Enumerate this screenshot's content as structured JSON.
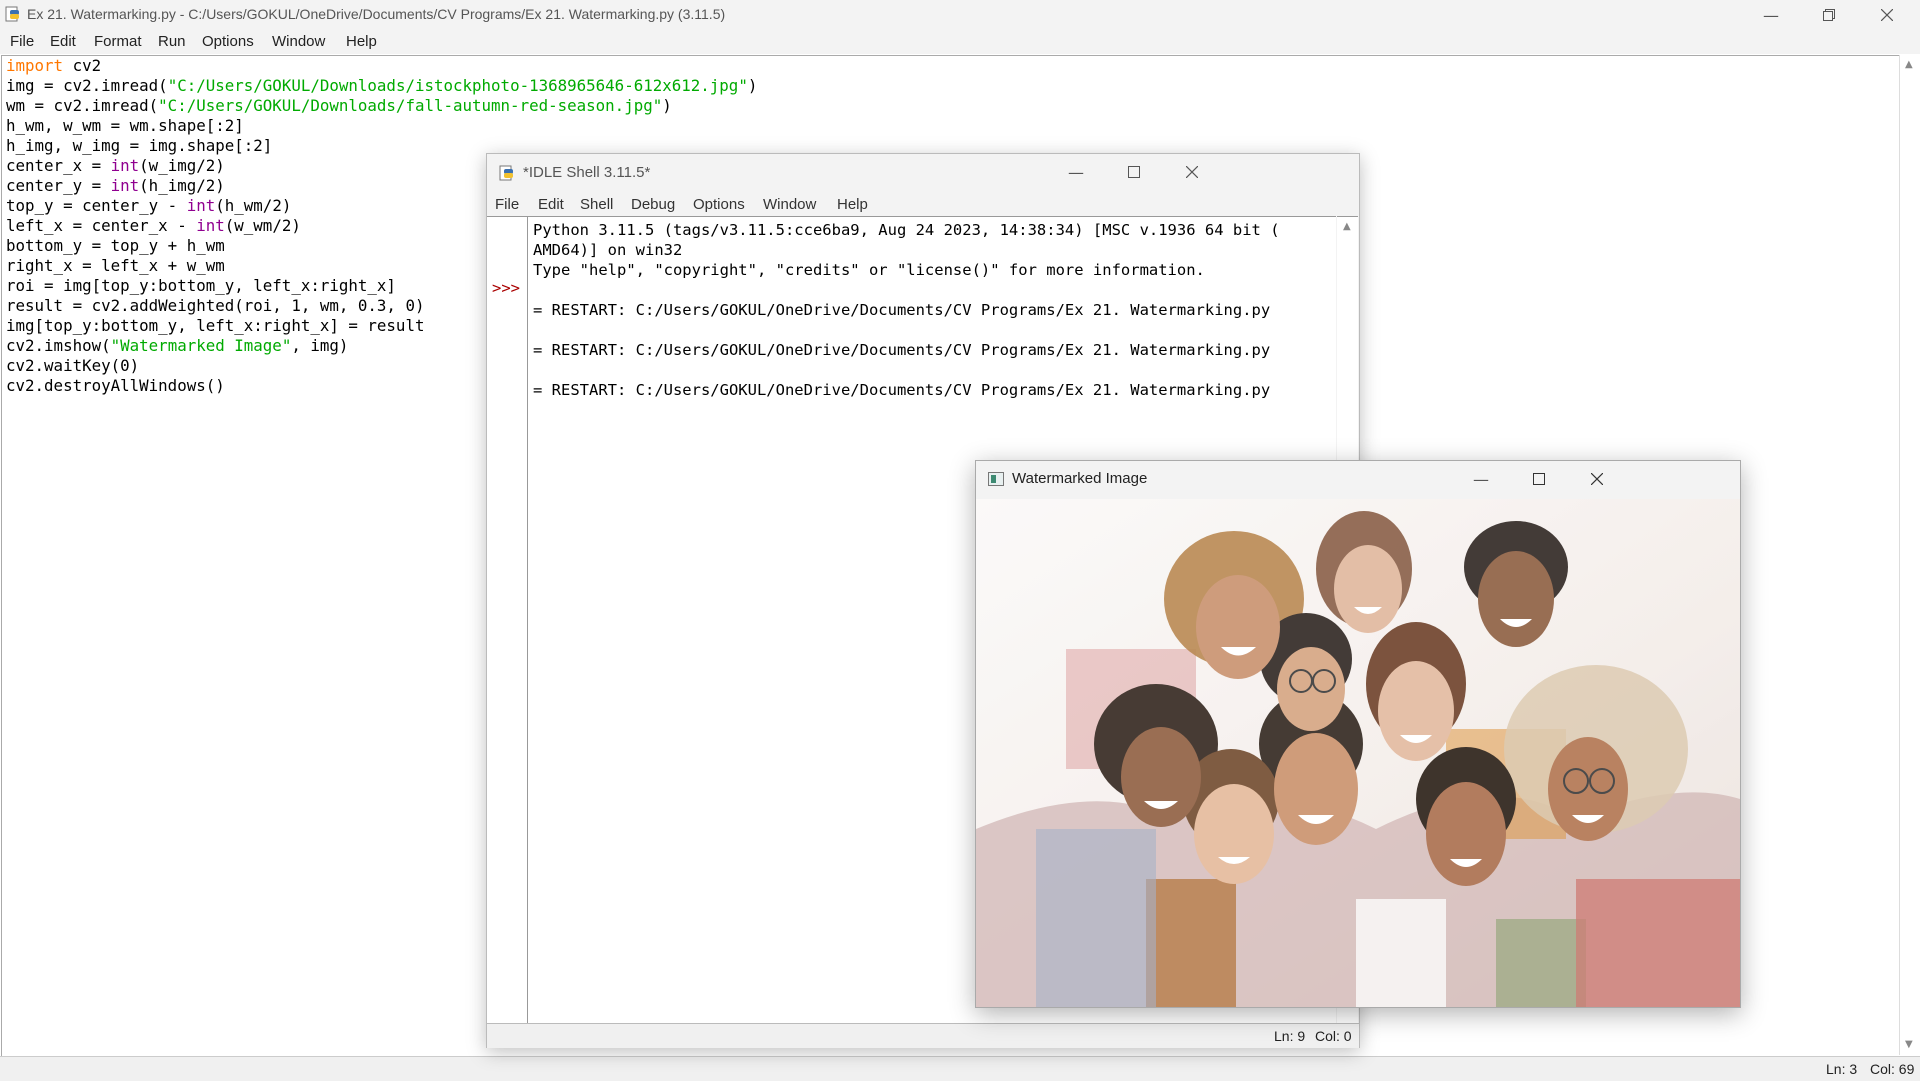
{
  "editor_window": {
    "title": "Ex 21. Watermarking.py - C:/Users/GOKUL/OneDrive/Documents/CV Programs/Ex 21. Watermarking.py (3.11.5)",
    "menu": [
      "File",
      "Edit",
      "Format",
      "Run",
      "Options",
      "Window",
      "Help"
    ],
    "status": {
      "line": "Ln: 3",
      "col": "Col: 69"
    }
  },
  "code_lines": [
    "import cv2",
    "img = cv2.imread(\"C:/Users/GOKUL/Downloads/istockphoto-1368965646-612x612.jpg\")",
    "wm = cv2.imread(\"C:/Users/GOKUL/Downloads/fall-autumn-red-season.jpg\")",
    "h_wm, w_wm = wm.shape[:2]",
    "h_img, w_img = img.shape[:2]",
    "center_x = int(w_img/2)",
    "center_y = int(h_img/2)",
    "top_y = center_y - int(h_wm/2)",
    "left_x = center_x - int(w_wm/2)",
    "bottom_y = top_y + h_wm",
    "right_x = left_x + w_wm",
    "roi = img[top_y:bottom_y, left_x:right_x]",
    "result = cv2.addWeighted(roi, 1, wm, 0.3, 0)",
    "img[top_y:bottom_y, left_x:right_x] = result",
    "cv2.imshow(\"Watermarked Image\", img)",
    "cv2.waitKey(0)",
    "cv2.destroyAllWindows()"
  ],
  "shell_window": {
    "title": "*IDLE Shell 3.11.5*",
    "menu": [
      "File",
      "Edit",
      "Shell",
      "Debug",
      "Options",
      "Window",
      "Help"
    ],
    "prompt": ">>>",
    "output": [
      "Python 3.11.5 (tags/v3.11.5:cce6ba9, Aug 24 2023, 14:38:34) [MSC v.1936 64 bit (",
      "AMD64)] on win32",
      "Type \"help\", \"copyright\", \"credits\" or \"license()\" for more information.",
      "",
      "= RESTART: C:/Users/GOKUL/OneDrive/Documents/CV Programs/Ex 21. Watermarking.py",
      "",
      "= RESTART: C:/Users/GOKUL/OneDrive/Documents/CV Programs/Ex 21. Watermarking.py",
      "",
      "= RESTART: C:/Users/GOKUL/OneDrive/Documents/CV Programs/Ex 21. Watermarking.py"
    ],
    "status": {
      "line": "Ln: 9",
      "col": "Col: 0"
    }
  },
  "image_window": {
    "title": "Watermarked Image"
  },
  "colors": {
    "keyword": "#ff7700",
    "builtin": "#900090",
    "string": "#00aa00",
    "titlebar": "#f3f3f3"
  },
  "icons": [
    "python-file-icon",
    "minimize-icon",
    "maximize-icon",
    "close-icon",
    "opencv-window-icon"
  ]
}
